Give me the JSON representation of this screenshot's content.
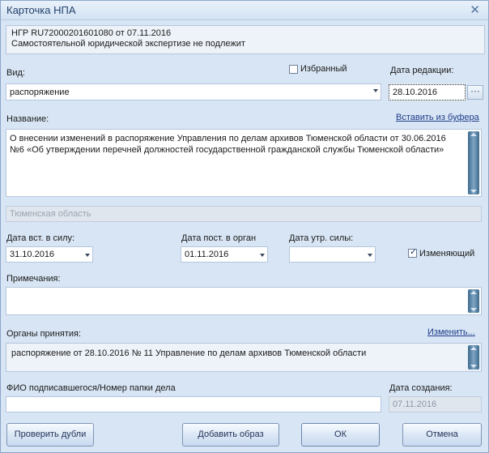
{
  "window": {
    "title": "Карточка НПА"
  },
  "info": {
    "line1": "НГР RU72000201601080 от 07.11.2016",
    "line2": "Самостоятельной юридической экспертизе не подлежит"
  },
  "vid": {
    "label": "Вид:",
    "value": "распоряжение"
  },
  "favorite": {
    "label": "Избранный",
    "checked": false
  },
  "edit_date": {
    "label": "Дата редакции:",
    "value": "28.10.2016",
    "button": "···"
  },
  "name": {
    "label": "Название:",
    "paste_link": "Вставить из буфера",
    "line1": "О внесении изменений в распоряжение Управления по делам архивов Тюменской области от 30.06.2016",
    "line2": "№6 «Об утверждении перечней должностей государственной гражданской службы Тюменской области»"
  },
  "region": {
    "value": "Тюменская область"
  },
  "date_effective": {
    "label": "Дата вст. в силу:",
    "value": "31.10.2016"
  },
  "date_received": {
    "label": "Дата пост. в орган",
    "value": "01.11.2016"
  },
  "date_expired": {
    "label": "Дата утр. силы:",
    "value": ""
  },
  "modifying": {
    "label": "Изменяющий",
    "checked": true
  },
  "notes": {
    "label": "Примечания:",
    "value": ""
  },
  "organs": {
    "label": "Органы принятия:",
    "change_link": "Изменить...",
    "value": "распоряжение от 28.10.2016 № 11 Управление по делам архивов Тюменской области"
  },
  "signer": {
    "label": "ФИО подписавшегося/Номер папки дела",
    "value": ""
  },
  "created": {
    "label": "Дата создания:",
    "value": "07.11.2016"
  },
  "buttons": {
    "check_duplicates": "Проверить дубли",
    "add_image": "Добавить образ",
    "ok": "ОК",
    "cancel": "Отмена"
  }
}
